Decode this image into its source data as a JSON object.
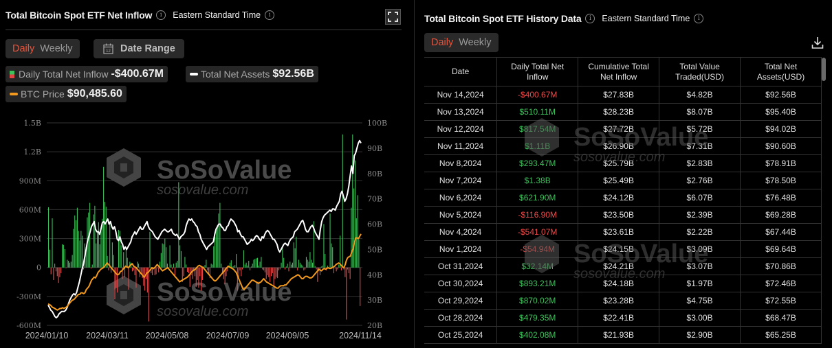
{
  "left_panel": {
    "title": "Total Bitcoin Spot ETF Net Inflow",
    "timezone": "Eastern Standard Time",
    "tabs": [
      {
        "label": "Daily",
        "active": true
      },
      {
        "label": "Weekly",
        "active": false
      }
    ],
    "date_range_label": "Date Range",
    "calendar_day": "12",
    "legend": [
      {
        "name": "Daily Total Net Inflow",
        "value": "-$400.67M"
      },
      {
        "name": "Total Net Assets",
        "value": "$92.56B"
      },
      {
        "name": "BTC Price",
        "value": "$90,485.60"
      }
    ]
  },
  "watermark": {
    "brand": "SoSoValue",
    "site": "sosovalue.com"
  },
  "colors": {
    "accent": "#e8533b",
    "positive": "#3ec05c",
    "negative": "#e84a4a",
    "assets_line": "#ffffff",
    "price_line": "#f39a1e"
  },
  "chart_data": {
    "type": "bar",
    "title": "Total Bitcoin Spot ETF Net Inflow",
    "left_axis": {
      "ticks": [
        "1.5B",
        "1.2B",
        "900M",
        "600M",
        "300M",
        "0",
        "-300M",
        "-600M"
      ],
      "range_millions": [
        -600,
        1500
      ]
    },
    "right_axis": {
      "ticks": [
        "100B",
        "90B",
        "80B",
        "70B",
        "60B",
        "50B",
        "40B",
        "30B",
        "20B"
      ],
      "range_billions": [
        20,
        100
      ]
    },
    "x_ticks": [
      "2024/01/10",
      "2024/03/11",
      "2024/05/08",
      "2024/07/09",
      "2024/09/05",
      "2024/11/14"
    ],
    "grid": true,
    "series": [
      {
        "name": "Daily Total Net Inflow",
        "type": "bar",
        "unit": "USD millions",
        "values": [
          625,
          185,
          -70,
          510,
          -130,
          40,
          -40,
          -90,
          -160,
          -100,
          -60,
          240,
          235,
          190,
          -5,
          80,
          70,
          50,
          60,
          130,
          400,
          540,
          490,
          620,
          380,
          280,
          380,
          330,
          -20,
          250,
          210,
          520,
          570,
          670,
          -10,
          30,
          550,
          640,
          250,
          380,
          470,
          240,
          410,
          505,
          1045,
          680,
          630,
          120,
          -30,
          460,
          -55,
          260,
          130,
          -330,
          -210,
          -260,
          390,
          380,
          230,
          -120,
          160,
          -100,
          200,
          100,
          -230,
          60,
          50,
          -40,
          -30,
          -80,
          -210,
          60,
          40,
          -100,
          -65,
          -110,
          -190,
          -240,
          -120,
          -260,
          -560,
          370,
          -60,
          -80,
          -20,
          -80,
          -70,
          -5,
          -50,
          60,
          150,
          250,
          240,
          300,
          210,
          40,
          -10,
          230,
          30,
          -20,
          40,
          -90,
          50,
          70,
          885,
          230,
          170,
          -150,
          -90,
          110,
          30,
          -45,
          -60,
          -200,
          -80,
          -120,
          -40,
          -90,
          -200,
          -130,
          -210,
          -90,
          -240,
          -130,
          10,
          25,
          80,
          -30,
          -70,
          -110,
          40,
          30,
          220,
          320,
          400,
          440,
          560,
          670,
          40,
          -60,
          -120,
          -170,
          -90,
          -40,
          20,
          50,
          75,
          10,
          15,
          25,
          140,
          -240,
          -110,
          -30,
          -90,
          -20,
          180,
          30,
          50,
          20,
          70,
          -30,
          10,
          40,
          80,
          90,
          95,
          100,
          20,
          60,
          110,
          -20,
          -30,
          -50,
          -120,
          -80,
          -100,
          -150,
          -90,
          -60,
          -190,
          -120,
          -100,
          -110,
          -30,
          -20,
          50,
          200,
          100,
          -20,
          10,
          40,
          -40,
          60,
          30,
          50,
          260,
          200,
          320,
          -30,
          80,
          50,
          30,
          20,
          -30,
          -20,
          110,
          80,
          60,
          160,
          80,
          50,
          480,
          15,
          -20,
          -150,
          -40,
          -80,
          10,
          20,
          450,
          140,
          -30,
          20,
          -10,
          560,
          250,
          210,
          -60,
          -10,
          -40,
          -20,
          30,
          330,
          -30,
          1380,
          -20,
          -100,
          -540,
          -20,
          -60,
          -120,
          620,
          1380,
          820,
          1110,
          510,
          750,
          290,
          -400
        ]
      },
      {
        "name": "Total Net Assets",
        "type": "line",
        "unit": "USD billions",
        "values": [
          28,
          27,
          26,
          25.5,
          24.5,
          23.5,
          23,
          23.5,
          24.5,
          25,
          25.5,
          25.5,
          25.5,
          26,
          27,
          28.5,
          30,
          31,
          32,
          32.5,
          32,
          33,
          35,
          37,
          39.5,
          42,
          44,
          47,
          50,
          53,
          55,
          57,
          59,
          60,
          61,
          58,
          57,
          57,
          56,
          58,
          60.5,
          61,
          60,
          61,
          62,
          60,
          61,
          59,
          58,
          59,
          57,
          54,
          53.5,
          55,
          53,
          52,
          50,
          51,
          50,
          51,
          52,
          53,
          55,
          56,
          57,
          56,
          57,
          58,
          59,
          58,
          58,
          59,
          60,
          61,
          59,
          58,
          57.5,
          57,
          56,
          55,
          54.5,
          54,
          55,
          56,
          57,
          57.5,
          58,
          57.5,
          57,
          57,
          57.5,
          58,
          56.5,
          56,
          55.5,
          56,
          55,
          54,
          55,
          55.5,
          56,
          57,
          59.5,
          61,
          62,
          61.5,
          62,
          61,
          60.5,
          59.5,
          59,
          57,
          56,
          54,
          53,
          52,
          51,
          50,
          51,
          51.5,
          52,
          52.5,
          53,
          56,
          58,
          59,
          60,
          60,
          59,
          58.5,
          57.5,
          57.5,
          59,
          59.5,
          61,
          62,
          61.5,
          61,
          60,
          59,
          57,
          57.5,
          56,
          55,
          55,
          54,
          53,
          52,
          52.5,
          53,
          54,
          53.5,
          54,
          55,
          55.5,
          55,
          54,
          53.5,
          55,
          54.5,
          56,
          57,
          57.5,
          57,
          56,
          55,
          54,
          54,
          53,
          52,
          50,
          49,
          50,
          51,
          52,
          52.5,
          52,
          51.5,
          53,
          54,
          54.5,
          55,
          57,
          57.5,
          58,
          59,
          60,
          61,
          61.5,
          60,
          58,
          57,
          57,
          58,
          59,
          59.5,
          58.5,
          57,
          56,
          55,
          54,
          58,
          61,
          62.5,
          63.5,
          64,
          64.5,
          65,
          65.5,
          65,
          66,
          66,
          65.5,
          67,
          68,
          69,
          72,
          73,
          71,
          69,
          70,
          72,
          75,
          79,
          83,
          80,
          87,
          88,
          90,
          92,
          93,
          92
        ]
      },
      {
        "name": "BTC Price",
        "type": "line",
        "unit": "USD thousands",
        "values": [
          46,
          45.5,
          45,
          44,
          43.5,
          43,
          42.5,
          42,
          42.5,
          43,
          43,
          43.5,
          43,
          43.5,
          44,
          45,
          46,
          47,
          48,
          48.5,
          49,
          50,
          51,
          52,
          52,
          53,
          53,
          52.5,
          53,
          55,
          56,
          57,
          59,
          61,
          62,
          63,
          62.5,
          64,
          66,
          67,
          68,
          68.5,
          69,
          70,
          71,
          72,
          71,
          70,
          69,
          68,
          67,
          66,
          65,
          64.5,
          65,
          66.5,
          67,
          68,
          69,
          70,
          69.5,
          69,
          70,
          71,
          71.5,
          70,
          69.5,
          69,
          68,
          67,
          66,
          65,
          64,
          63,
          64,
          65.5,
          66,
          67,
          68,
          69,
          68.5,
          69,
          70,
          71,
          70,
          69,
          68,
          67,
          67.5,
          68,
          68.5,
          69,
          68,
          67,
          66,
          65,
          64,
          63,
          62,
          61,
          60,
          60.5,
          61,
          61.5,
          62,
          62.5,
          63,
          64,
          65,
          66,
          67,
          67.5,
          68,
          69,
          70,
          70.5,
          70,
          69.5,
          69,
          68,
          67,
          66,
          65,
          64,
          63,
          62,
          61,
          60.5,
          61,
          62,
          63,
          64,
          65,
          66,
          67,
          68,
          69,
          70,
          69.5,
          69,
          68.5,
          68,
          67,
          66,
          64,
          62,
          60,
          58,
          56,
          55,
          56,
          57,
          58,
          59,
          60,
          61,
          61,
          60.5,
          60,
          59.5,
          59,
          59.5,
          60,
          61,
          62,
          61,
          60,
          59.5,
          59,
          58.5,
          58,
          57.5,
          57,
          56.5,
          56,
          56,
          57,
          57.5,
          57.5,
          57.5,
          58,
          58,
          59,
          60,
          61,
          62,
          62.5,
          63,
          63.5,
          64,
          64.5,
          64,
          63,
          62,
          62,
          63,
          63.5,
          63.5,
          63,
          62.5,
          62.5,
          63,
          64,
          65,
          66,
          67,
          68,
          67.5,
          67,
          68,
          68.5,
          68,
          68.5,
          69,
          68.5,
          68.5,
          69,
          69.5,
          70,
          71,
          71.5,
          72,
          71.5,
          70.5,
          69.5,
          69,
          71,
          74,
          75.5,
          76,
          76.5,
          79,
          81,
          85,
          88,
          88,
          87.5,
          89,
          90.5
        ]
      }
    ]
  },
  "right_panel": {
    "title": "Total Bitcoin Spot ETF History Data",
    "timezone": "Eastern Standard Time",
    "tabs": [
      {
        "label": "Daily",
        "active": true
      },
      {
        "label": "Weekly",
        "active": false
      }
    ],
    "columns": [
      "Date",
      "Daily Total Net Inflow",
      "Cumulative Total Net Inflow",
      "Total Value Traded(USD)",
      "Total Net Assets(USD)"
    ],
    "rows": [
      {
        "date": "Nov 14,2024",
        "inflow": "-$400.67M",
        "cumulative": "$27.83B",
        "traded": "$4.82B",
        "assets": "$92.56B",
        "sign": "neg"
      },
      {
        "date": "Nov 13,2024",
        "inflow": "$510.11M",
        "cumulative": "$28.23B",
        "traded": "$8.07B",
        "assets": "$95.40B",
        "sign": "pos"
      },
      {
        "date": "Nov 12,2024",
        "inflow": "$817.54M",
        "cumulative": "$27.72B",
        "traded": "$5.72B",
        "assets": "$94.02B",
        "sign": "pos"
      },
      {
        "date": "Nov 11,2024",
        "inflow": "$1.11B",
        "cumulative": "$26.90B",
        "traded": "$7.31B",
        "assets": "$90.60B",
        "sign": "pos"
      },
      {
        "date": "Nov 8,2024",
        "inflow": "$293.47M",
        "cumulative": "$25.79B",
        "traded": "$2.83B",
        "assets": "$78.91B",
        "sign": "pos"
      },
      {
        "date": "Nov 7,2024",
        "inflow": "$1.38B",
        "cumulative": "$25.49B",
        "traded": "$2.76B",
        "assets": "$78.50B",
        "sign": "pos"
      },
      {
        "date": "Nov 6,2024",
        "inflow": "$621.90M",
        "cumulative": "$24.12B",
        "traded": "$6.07B",
        "assets": "$76.48B",
        "sign": "pos"
      },
      {
        "date": "Nov 5,2024",
        "inflow": "-$116.90M",
        "cumulative": "$23.50B",
        "traded": "$2.39B",
        "assets": "$69.28B",
        "sign": "neg"
      },
      {
        "date": "Nov 4,2024",
        "inflow": "-$541.07M",
        "cumulative": "$23.61B",
        "traded": "$2.22B",
        "assets": "$67.44B",
        "sign": "neg"
      },
      {
        "date": "Nov 1,2024",
        "inflow": "-$54.94M",
        "cumulative": "$24.15B",
        "traded": "$3.09B",
        "assets": "$69.64B",
        "sign": "neg"
      },
      {
        "date": "Oct 31,2024",
        "inflow": "$32.14M",
        "cumulative": "$24.21B",
        "traded": "$3.07B",
        "assets": "$70.86B",
        "sign": "pos"
      },
      {
        "date": "Oct 30,2024",
        "inflow": "$893.21M",
        "cumulative": "$24.18B",
        "traded": "$1.97B",
        "assets": "$72.46B",
        "sign": "pos"
      },
      {
        "date": "Oct 29,2024",
        "inflow": "$870.02M",
        "cumulative": "$23.28B",
        "traded": "$4.75B",
        "assets": "$72.55B",
        "sign": "pos"
      },
      {
        "date": "Oct 28,2024",
        "inflow": "$479.35M",
        "cumulative": "$22.41B",
        "traded": "$3.00B",
        "assets": "$68.47B",
        "sign": "pos"
      },
      {
        "date": "Oct 25,2024",
        "inflow": "$402.08M",
        "cumulative": "$21.93B",
        "traded": "$2.90B",
        "assets": "$65.25B",
        "sign": "pos"
      }
    ]
  }
}
